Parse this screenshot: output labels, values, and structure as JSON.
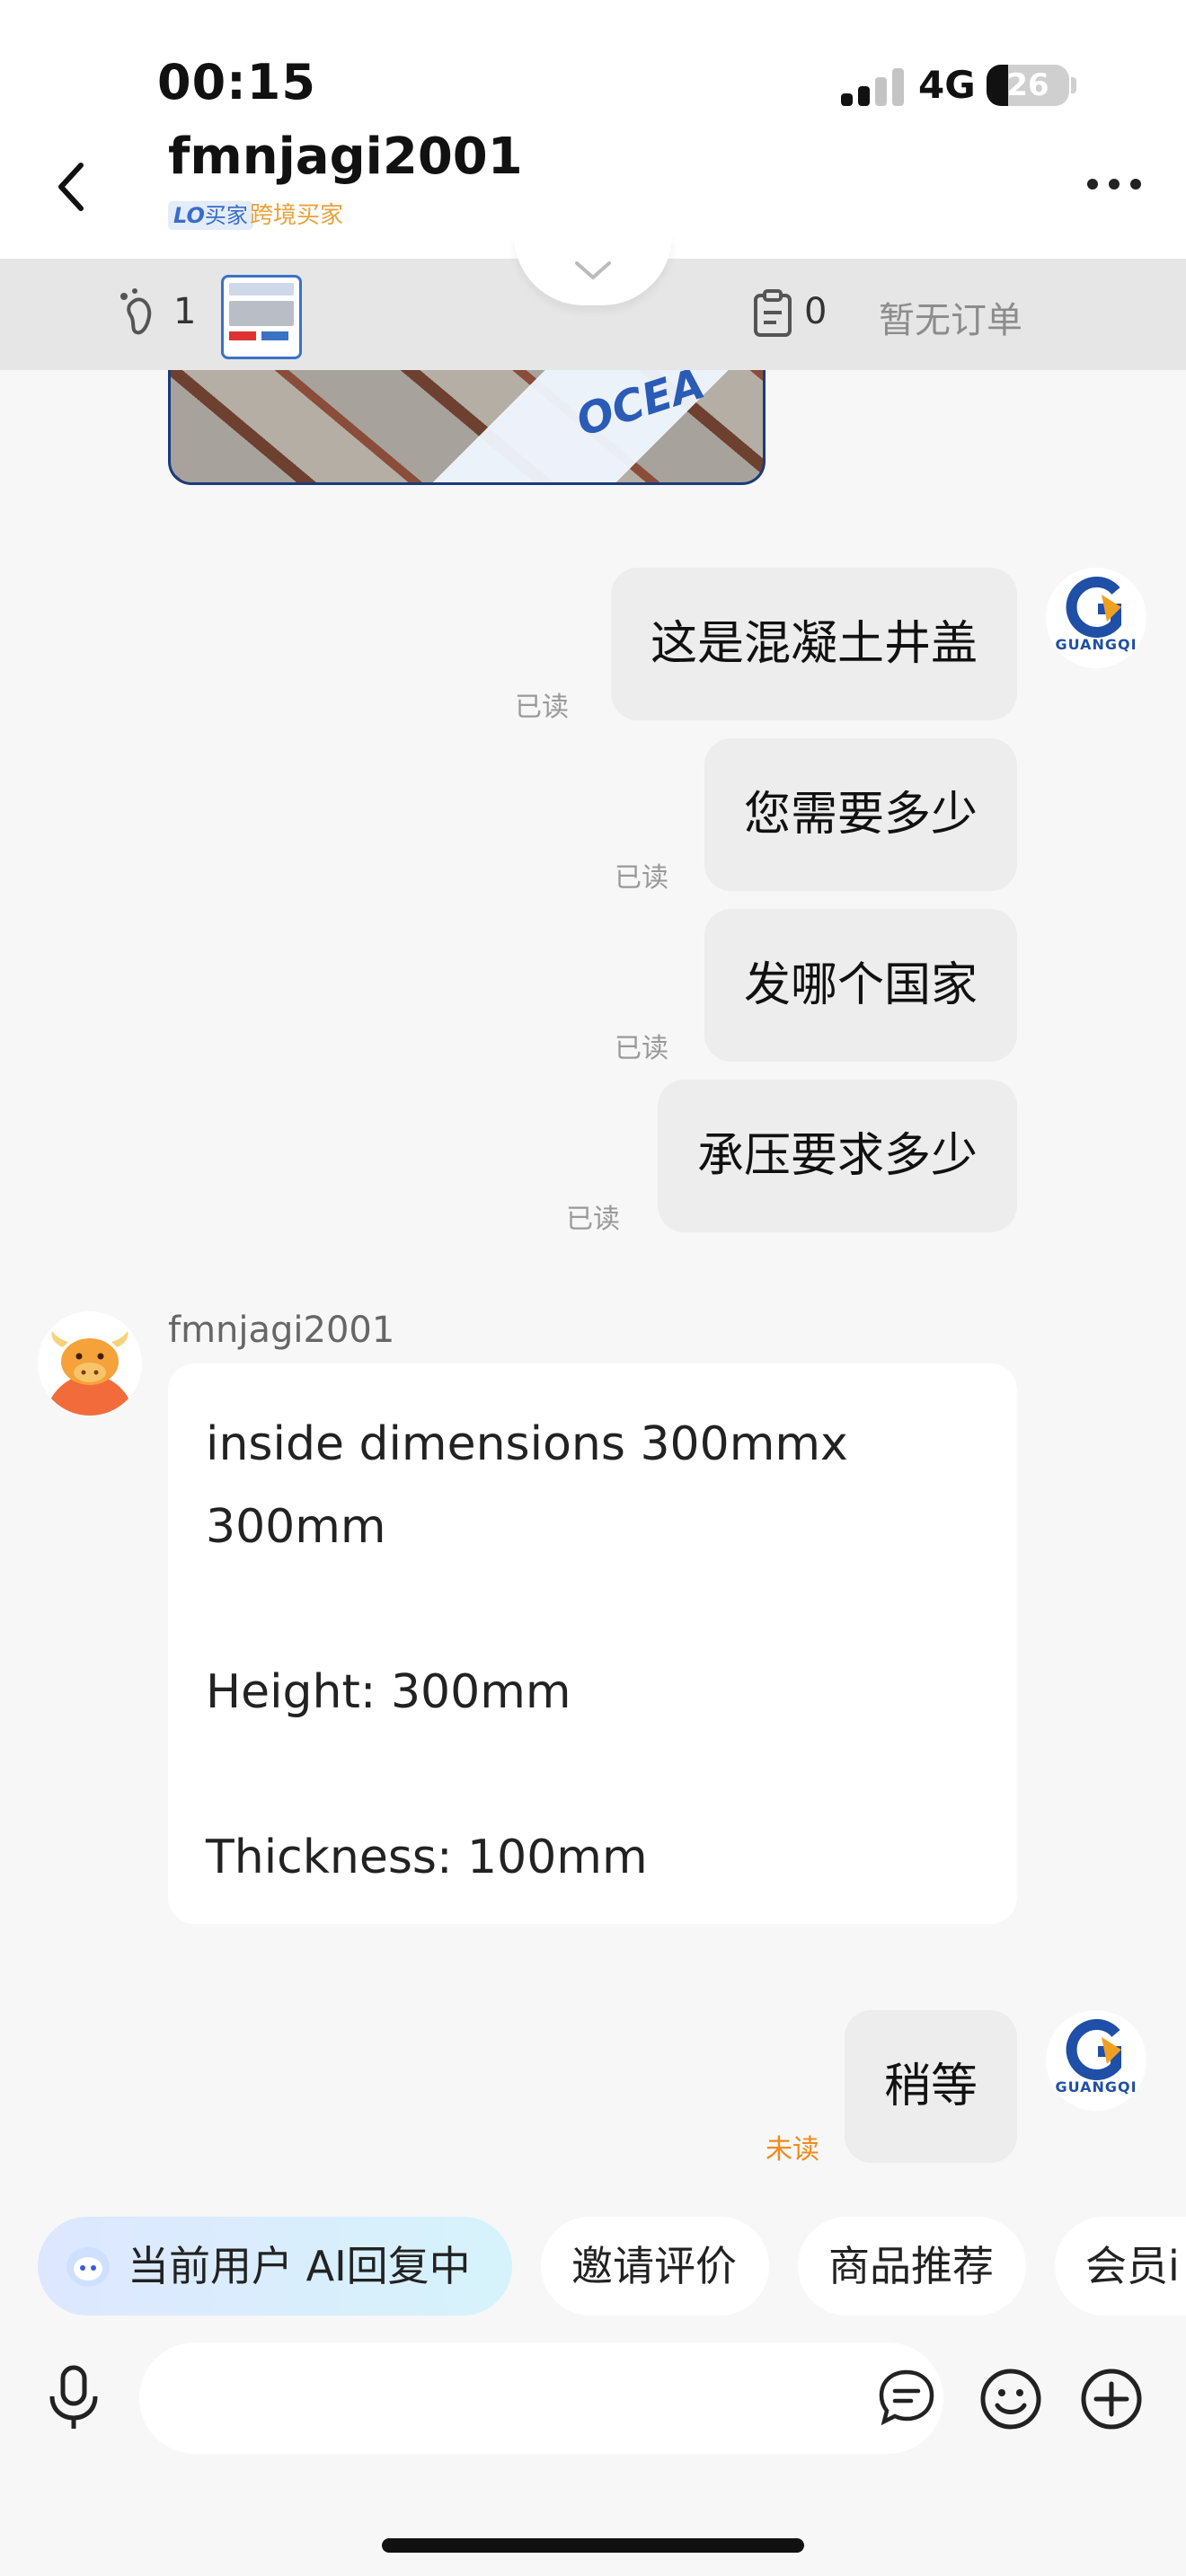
{
  "status_bar": {
    "time": "00:15",
    "network": "4G",
    "battery": "26",
    "battery_level": 0.26
  },
  "header": {
    "title": "fmnjagi2001",
    "buyer_tag": "LO买家",
    "buyer_tag_badge": "LO",
    "buyer_tag_text": "买家",
    "cross_border_tag": "跨境买家"
  },
  "info_bar": {
    "footprint_count": "1",
    "order_count": "0",
    "no_order_text": "暂无订单"
  },
  "image_message": {
    "watermark": "OCEA"
  },
  "messages_me": [
    {
      "text": "这是混凝土井盖",
      "status": "已读"
    },
    {
      "text": "您需要多少",
      "status": "已读"
    },
    {
      "text": "发哪个国家",
      "status": "已读"
    },
    {
      "text": "承压要求多少",
      "status": "已读"
    }
  ],
  "avatar_me": {
    "logo_text": "GUANGQI"
  },
  "message_other": {
    "sender": "fmnjagi2001",
    "lines": [
      "inside dimensions 300mmx",
      "300mm",
      "",
      "Height: 300mm",
      "",
      "Thickness:  100mm"
    ]
  },
  "last_message_me": {
    "text": "稍等",
    "status": "未读"
  },
  "quick_replies": {
    "ai_label": "当前用户 AI回复中",
    "chips": [
      "邀请评价",
      "商品推荐",
      "会员i"
    ]
  },
  "input": {
    "placeholder": ""
  },
  "colors": {
    "unread": "#f08a1c",
    "read": "#999999",
    "brand_blue": "#1f4fa6"
  }
}
